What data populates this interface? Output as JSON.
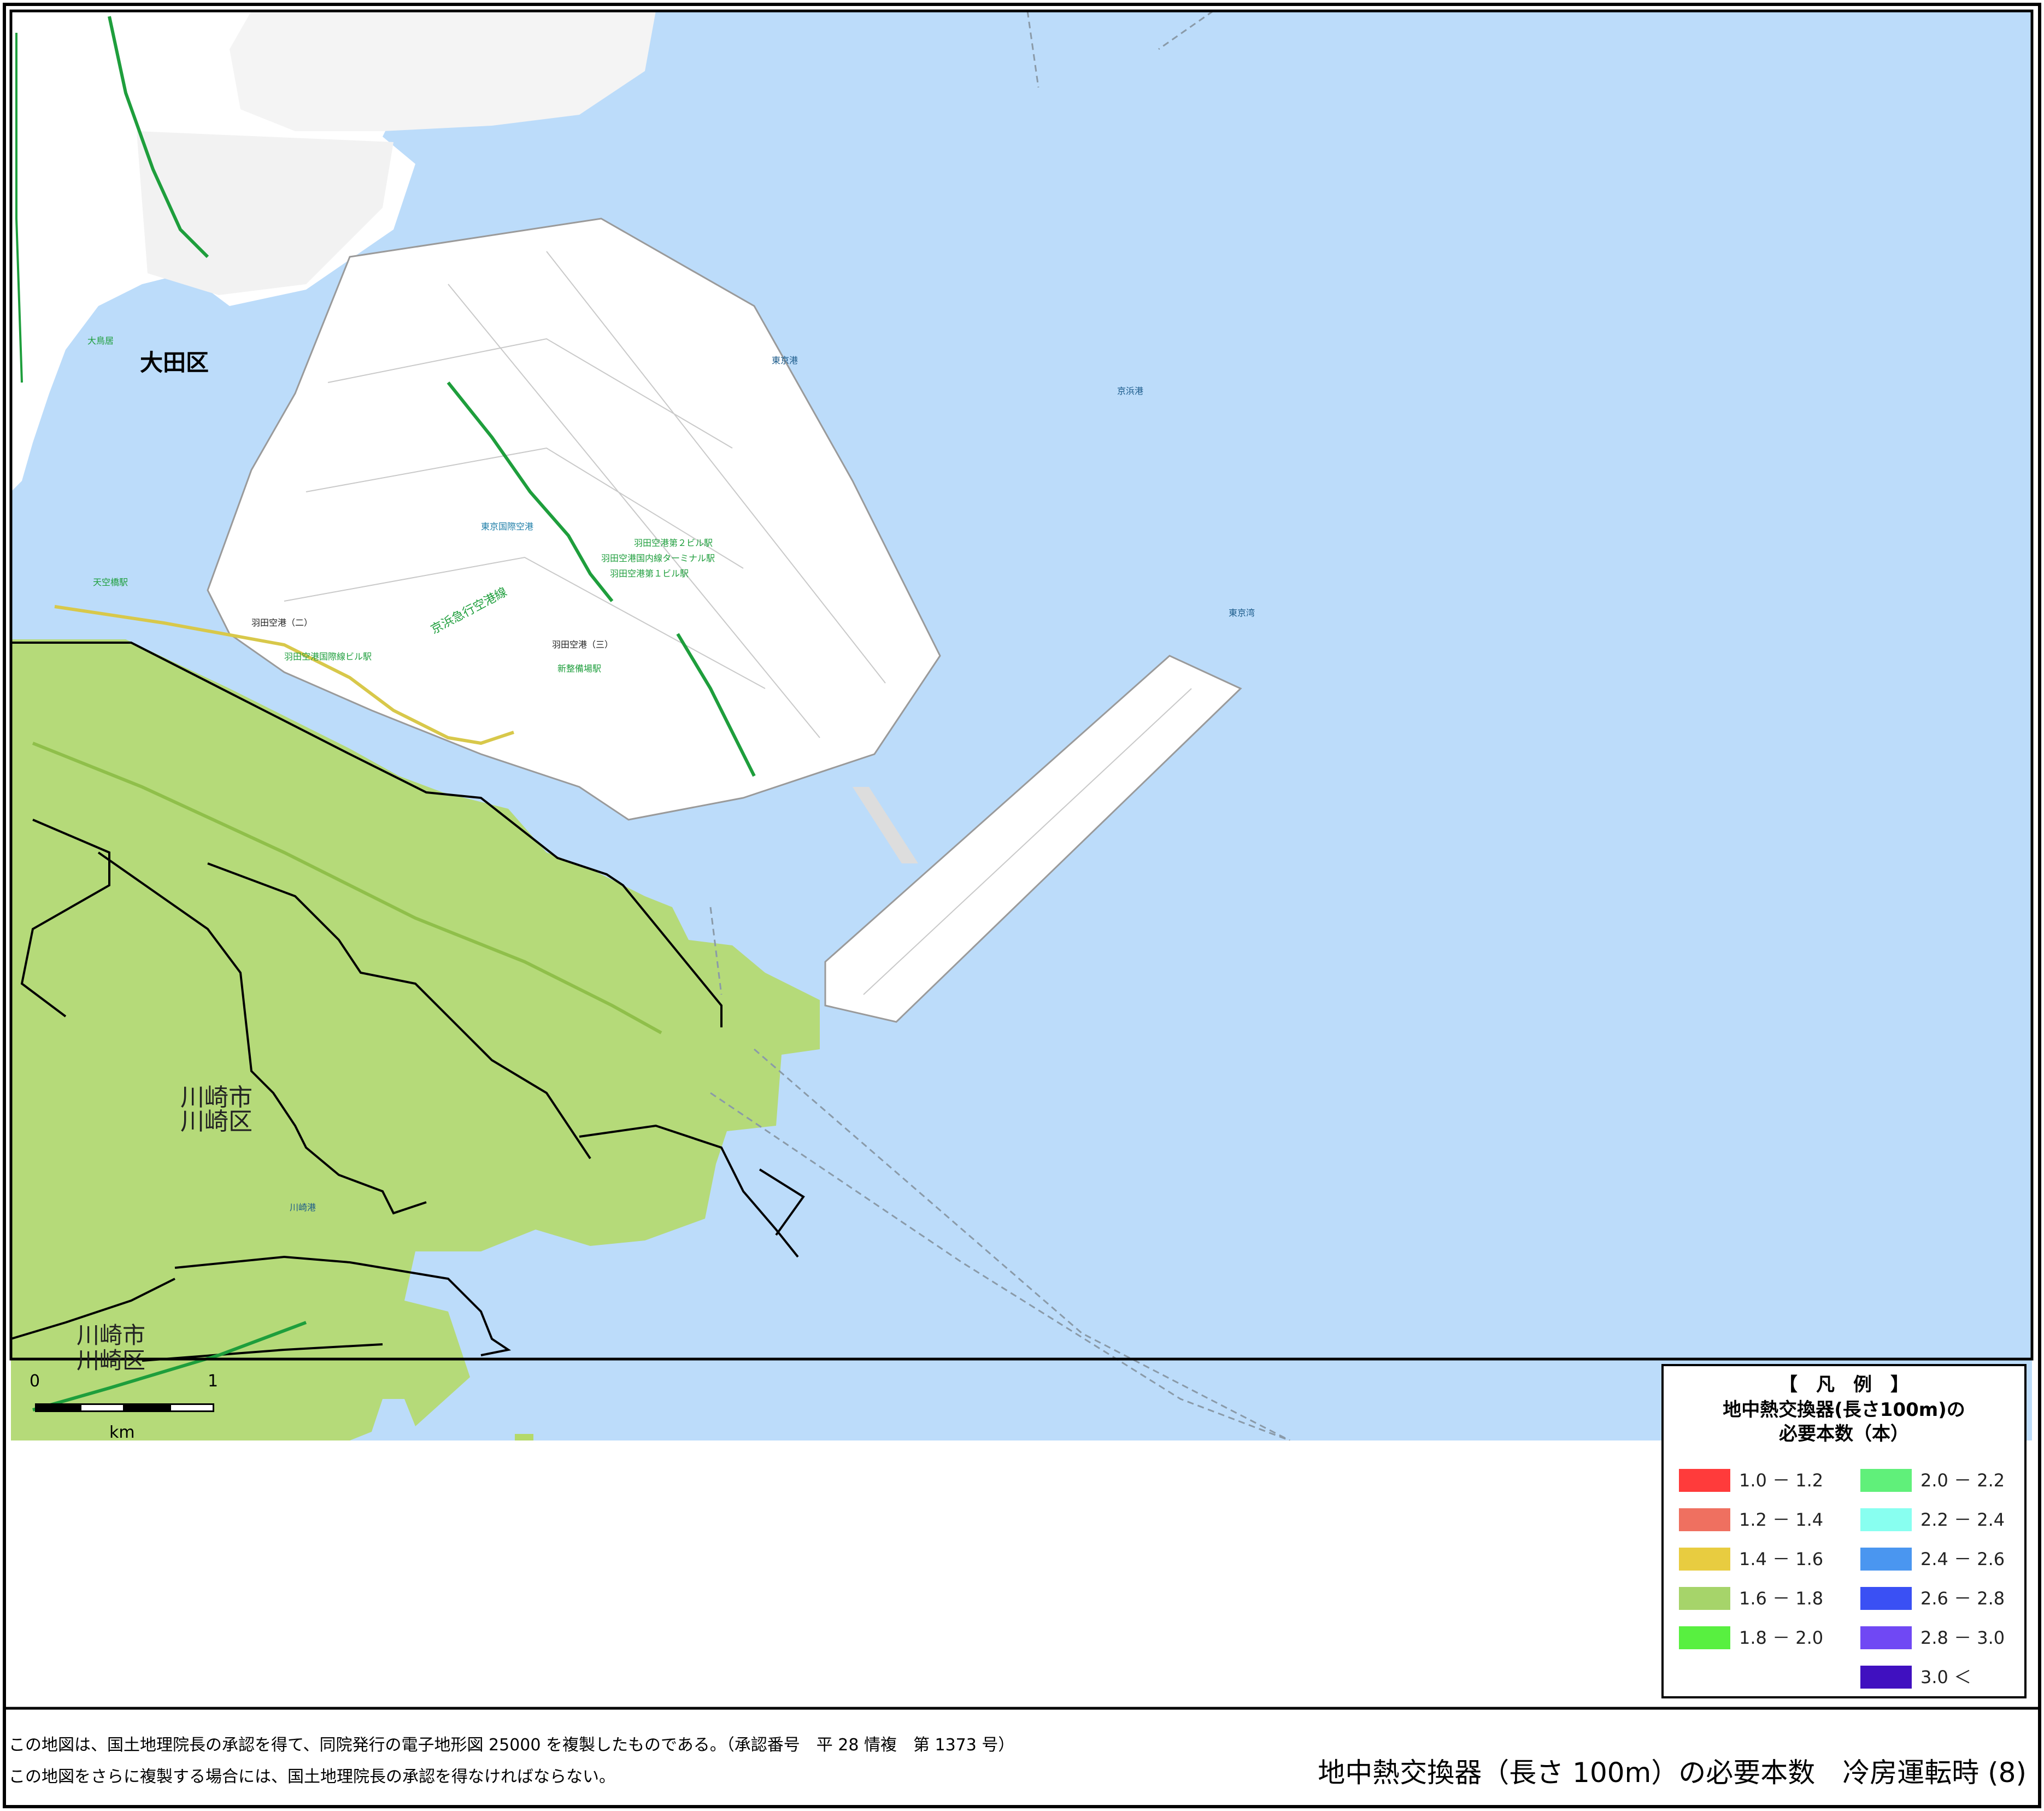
{
  "map": {
    "ward_labels": [
      "大田区",
      "川崎市",
      "川崎区",
      "川崎市",
      "川崎区"
    ],
    "sea_labels": [
      "東京港",
      "京浜港",
      "東京湾"
    ],
    "place_labels": [
      "羽田空港（二）",
      "羽田空港（三）",
      "東京国際空港",
      "京浜急行空港線",
      "大鳥居",
      "川崎港"
    ],
    "station_labels": [
      "羽田空港第２ビル駅",
      "羽田空港国内線ターミナル駅",
      "羽田空港第１ビル駅",
      "羽田空港国際線ビル駅",
      "新整備場駅",
      "天空橋駅"
    ]
  },
  "colors": {
    "sea": "#bcdcfa",
    "land": "#ffffff",
    "class_1_6_1_8": "#a8d46a",
    "class_1_6_1_8_fill": "#b4d96a",
    "rail_green": "#1e9e3c",
    "rail_yellow": "#d8c84a",
    "border": "#000000"
  },
  "legend": {
    "title": "【　凡　例　】",
    "subtitle_line1": "地中熱交換器(長さ100m)の",
    "subtitle_line2": "必要本数（本）",
    "left": [
      {
        "label": "1.0 － 1.2",
        "color": "#ff3b3b"
      },
      {
        "label": "1.2 － 1.4",
        "color": "#ef7060"
      },
      {
        "label": "1.4 － 1.6",
        "color": "#e8cc40"
      },
      {
        "label": "1.6 － 1.8",
        "color": "#a6d46a"
      },
      {
        "label": "1.8 － 2.0",
        "color": "#58f040"
      }
    ],
    "right": [
      {
        "label": "2.0 － 2.2",
        "color": "#60f07a"
      },
      {
        "label": "2.2 － 2.4",
        "color": "#88fff0"
      },
      {
        "label": "2.4 － 2.6",
        "color": "#4a96f0"
      },
      {
        "label": "2.6 － 2.8",
        "color": "#3a50f4"
      },
      {
        "label": "2.8 － 3.0",
        "color": "#7048f4"
      },
      {
        "label": "3.0 ＜",
        "color": "#4010c0"
      }
    ]
  },
  "scale": {
    "left_value": "0",
    "right_value": "1",
    "unit": "km"
  },
  "footer": {
    "line1": "この地図は、国土地理院長の承認を得て、同院発行の電子地形図 25000 を複製したものである。（承認番号　平 28 情複　第 1373 号）",
    "line2": "この地図をさらに複製する場合には、国土地理院長の承認を得なければならない。",
    "title": "地中熱交換器（長さ 100m）の必要本数　冷房運転時 (8)"
  }
}
